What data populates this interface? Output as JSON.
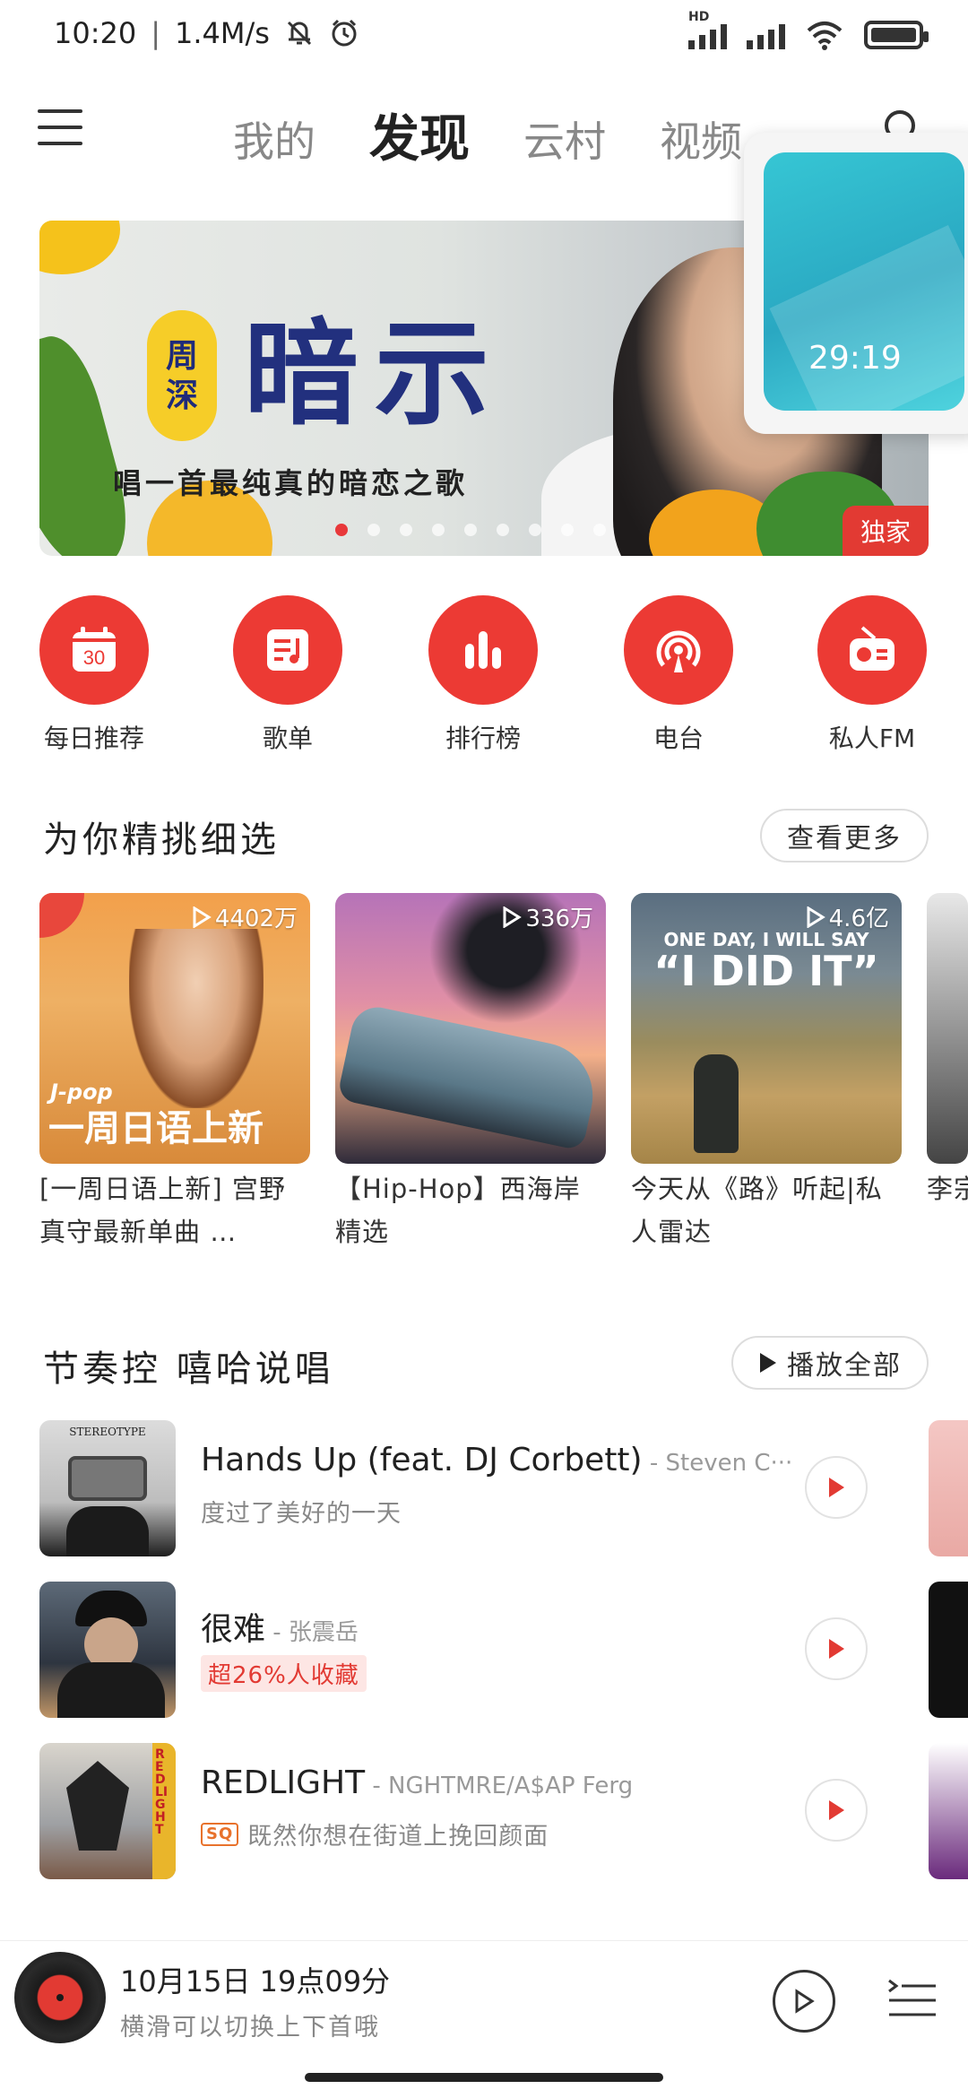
{
  "status_bar": {
    "time": "10:20",
    "speed": "1.4M/s",
    "hd_label": "HD"
  },
  "nav": {
    "tabs": [
      "我的",
      "发现",
      "云村",
      "视频"
    ],
    "active_tab": "发现"
  },
  "floating_video": {
    "time": "29:19"
  },
  "banner": {
    "badge_top": "周",
    "badge_bottom": "深",
    "title": "暗示",
    "subtitle": "唱一首最纯真的暗恋之歌",
    "tag": "独家",
    "dots_total": 9,
    "active_dot": 0
  },
  "quick_entries": [
    {
      "label": "每日推荐",
      "icon": "calendar-icon",
      "icon_text": "30"
    },
    {
      "label": "歌单",
      "icon": "playlist-icon"
    },
    {
      "label": "排行榜",
      "icon": "chart-icon"
    },
    {
      "label": "电台",
      "icon": "radio-icon"
    },
    {
      "label": "私人FM",
      "icon": "fm-icon"
    }
  ],
  "picks": {
    "title": "为你精挑细选",
    "more_label": "查看更多",
    "playlists": [
      {
        "count": "4402万",
        "title": "[一周日语上新] 宫野真守最新单曲 …",
        "cover_tag": "J-pop",
        "cover_text": "一周日语上新"
      },
      {
        "count": "336万",
        "title": "【Hip-Hop】西海岸精选"
      },
      {
        "count": "4.6亿",
        "title": "今天从《路》听起|私人雷达",
        "cover_line1": "ONE DAY, I WILL SAY",
        "cover_line2": "“I DID IT”"
      },
      {
        "count": "",
        "title": "李宗盛 深沉"
      }
    ]
  },
  "rhythm": {
    "title": "节奏控 嘻哈说唱",
    "play_all_label": "播放全部",
    "songs": [
      {
        "name": "Hands Up (feat. DJ Corbett)",
        "artist": " - Steven C···",
        "sub": "度过了美好的一天",
        "tag": "",
        "cover_text": "STEREOTYPE"
      },
      {
        "name": "很难",
        "artist": " - 张震岳",
        "sub": "",
        "tag": "超26%人收藏"
      },
      {
        "name": "REDLIGHT",
        "artist": " - NGHTMRE/A$AP Ferg",
        "sub": "既然你想在街道上挽回颜面",
        "tag": "SQ",
        "cover_text": "REDLIGHT"
      }
    ]
  },
  "player": {
    "title": "10月15日 19点09分",
    "subtitle": "横滑可以切换上下首哦"
  },
  "colors": {
    "accent": "#ec3a34",
    "text_primary": "#222222",
    "text_secondary": "#888888"
  }
}
